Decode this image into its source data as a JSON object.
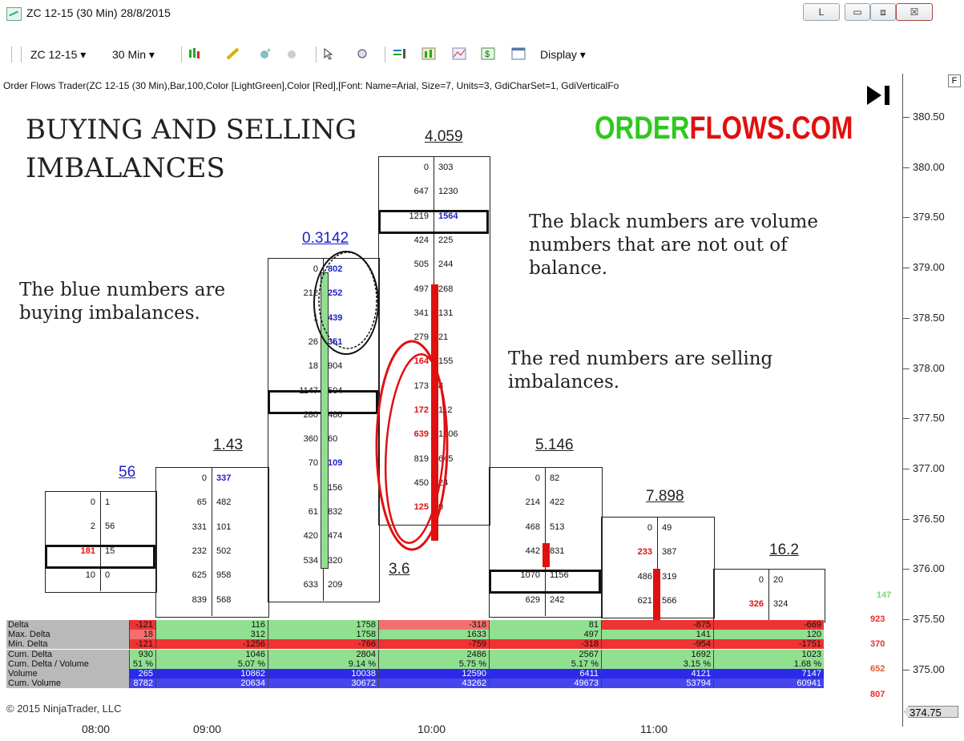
{
  "window": {
    "title": "ZC 12-15 (30 Min)  28/8/2015",
    "btn_l": "L",
    "btn_min": "▭",
    "btn_max": "⧈",
    "btn_close": "☒"
  },
  "toolbar": {
    "instrument": "ZC 12-15 ▾",
    "interval": "30 Min ▾",
    "display": "Display ▾"
  },
  "indicator_line": "Order Flows Trader(ZC 12-15 (30 Min),Bar,100,Color [LightGreen],Color [Red],[Font: Name=Arial, Size=7, Units=3, GdiCharSet=1, GdiVerticalFo",
  "annotations": {
    "title_line1": "BUYING AND SELLING",
    "title_line2": "IMBALANCES",
    "brand_a": "ORDER",
    "brand_b": "FLOWS.COM",
    "blue_note": "The blue numbers are buying imbalances.",
    "black_note": "The black numbers are volume numbers that are not out of balance.",
    "red_note": "The red numbers are selling imbalances."
  },
  "y_axis": [
    "380.50",
    "380.00",
    "379.50",
    "379.00",
    "378.50",
    "378.00",
    "377.50",
    "377.00",
    "376.50",
    "376.00",
    "375.50",
    "375.00"
  ],
  "y_current": "374.75",
  "x_axis": [
    "08:00",
    "09:00",
    "10:00",
    "11:00"
  ],
  "bars": [
    {
      "label": "56",
      "rows": [
        [
          "0",
          "1"
        ],
        [
          "2",
          "56"
        ],
        [
          "181",
          "15"
        ],
        [
          "10",
          "0"
        ]
      ]
    },
    {
      "label": "1.43",
      "rows": [
        [
          "0",
          "337"
        ],
        [
          "65",
          "482"
        ],
        [
          "331",
          "101"
        ],
        [
          "232",
          "502"
        ],
        [
          "625",
          "958"
        ],
        [
          "839",
          "568"
        ]
      ]
    },
    {
      "label": "0.3142",
      "rows": [
        [
          "0",
          "802"
        ],
        [
          "212",
          "252"
        ],
        [
          "1",
          "439"
        ],
        [
          "26",
          "351"
        ],
        [
          "18",
          "904"
        ],
        [
          "1147",
          "504"
        ],
        [
          "280",
          "486"
        ],
        [
          "360",
          "60"
        ],
        [
          "70",
          "109"
        ],
        [
          "5",
          "156"
        ],
        [
          "61",
          "832"
        ],
        [
          "420",
          "474"
        ],
        [
          "534",
          "320"
        ],
        [
          "633",
          "209"
        ]
      ]
    },
    {
      "label": "4.059",
      "rows": [
        [
          "0",
          "303"
        ],
        [
          "647",
          "1230"
        ],
        [
          "1219",
          "1564"
        ],
        [
          "424",
          "225"
        ],
        [
          "505",
          "244"
        ],
        [
          "497",
          "268"
        ],
        [
          "341",
          "131"
        ],
        [
          "279",
          "21"
        ],
        [
          "164",
          "155"
        ],
        [
          "173",
          "8"
        ],
        [
          "172",
          "112"
        ],
        [
          "639",
          "1206"
        ],
        [
          "819",
          "645"
        ],
        [
          "450",
          "24"
        ],
        [
          "125",
          "0"
        ]
      ],
      "bottom": "3.6"
    },
    {
      "label": "5.146",
      "rows": [
        [
          "0",
          "82"
        ],
        [
          "214",
          "422"
        ],
        [
          "468",
          "513"
        ],
        [
          "442",
          "831"
        ],
        [
          "1070",
          "1156"
        ],
        [
          "629",
          "242"
        ]
      ]
    },
    {
      "label": "7.898",
      "rows": [
        [
          "0",
          "49"
        ],
        [
          "233",
          "387"
        ],
        [
          "486",
          "319"
        ],
        [
          "621",
          "566"
        ]
      ]
    },
    {
      "label": "16.2",
      "rows": [
        [
          "0",
          "20"
        ],
        [
          "326",
          "324"
        ]
      ]
    }
  ],
  "right_values": [
    "147",
    "923",
    "370",
    "652",
    "807"
  ],
  "table": {
    "rows": [
      "Delta",
      "Max. Delta",
      "Min. Delta",
      "Cum. Delta",
      "Cum. Delta / Volume",
      "Volume",
      "Cum. Volume"
    ],
    "values": [
      [
        "-121",
        "116",
        "1758",
        "-318",
        "81",
        "-875",
        "-669"
      ],
      [
        "18",
        "312",
        "1758",
        "1633",
        "497",
        "141",
        "120"
      ],
      [
        "-121",
        "-1256",
        "-766",
        "-759",
        "-318",
        "-954",
        "-1751"
      ],
      [
        "930",
        "1046",
        "2804",
        "2486",
        "2567",
        "1692",
        "1023"
      ],
      [
        "51 %",
        "5.07 %",
        "9.14 %",
        "5.75 %",
        "5.17 %",
        "3.15 %",
        "1.68 %"
      ],
      [
        "265",
        "10862",
        "10038",
        "12590",
        "6411",
        "4121",
        "7147"
      ],
      [
        "8782",
        "20634",
        "30672",
        "43262",
        "49673",
        "53794",
        "60941"
      ]
    ],
    "copyright": "© 2015 NinjaTrader, LLC"
  }
}
